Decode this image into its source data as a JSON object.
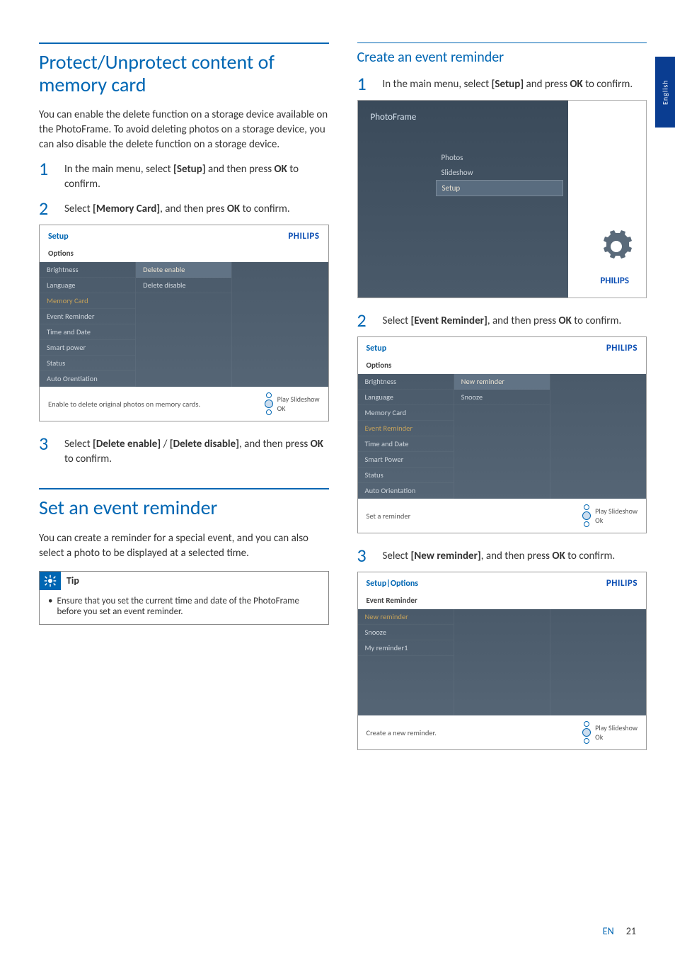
{
  "side_tab": "English",
  "left": {
    "h1": "Protect/Unprotect content of memory card",
    "intro": "You can enable the delete function on a storage device available on the PhotoFrame. To avoid deleting photos on a storage device, you can also disable the delete function on a storage device.",
    "step1_a": "In the main menu, select ",
    "step1_b": "[Setup]",
    "step1_c": " and then press ",
    "step1_d": "OK",
    "step1_e": " to confirm.",
    "step2_a": "Select ",
    "step2_b": "[Memory Card]",
    "step2_c": ", and then pres ",
    "step2_d": "OK",
    "step2_e": " to confirm.",
    "shot1": {
      "title": "Setup",
      "brand": "PHILIPS",
      "sub": "Options",
      "col1": [
        "Brightness",
        "Language",
        "Memory Card",
        "Event Reminder",
        "Time and Date",
        "Smart power",
        "Status",
        "Auto Orentiation"
      ],
      "col1_hl_index": 2,
      "col2": [
        "Delete enable",
        "Delete disable"
      ],
      "footer_text": "Enable to delete original photos on memory cards.",
      "play": "Play Slideshow",
      "ok": "OK"
    },
    "step3_a": "Select ",
    "step3_b": "[Delete enable]",
    "step3_c": " / ",
    "step3_d": "[Delete disable]",
    "step3_e": ", and then press ",
    "step3_f": "OK",
    "step3_g": " to confirm.",
    "h1b": "Set an event reminder",
    "intro2": "You can create a reminder for a special event, and you can also select a photo to be displayed at a selected time.",
    "tip_label": "Tip",
    "tip_text": "Ensure that you set the current time and date of the PhotoFrame before you set an event reminder."
  },
  "right": {
    "h2": "Create an event reminder",
    "step1_a": "In the main menu, select ",
    "step1_b": "[Setup]",
    "step1_c": " and press ",
    "step1_d": "OK",
    "step1_e": " to confirm.",
    "mainmenu": {
      "title": "PhotoFrame",
      "items": [
        "Photos",
        "Slideshow",
        "Setup"
      ],
      "sel_index": 2,
      "brand": "PHILIPS"
    },
    "step2_a": "Select ",
    "step2_b": "[Event Reminder]",
    "step2_c": ", and then press ",
    "step2_d": "OK",
    "step2_e": " to confirm.",
    "shot2": {
      "title": "Setup",
      "brand": "PHILIPS",
      "sub": "Options",
      "col1": [
        "Brightness",
        "Language",
        "Memory Card",
        "Event Reminder",
        "Time and Date",
        "Smart Power",
        "Status",
        "Auto Orientation"
      ],
      "col1_hl_index": 3,
      "col2": [
        "New reminder",
        "Snooze"
      ],
      "footer_text": "Set a reminder",
      "play": "Play Slideshow",
      "ok": "Ok"
    },
    "step3_a": "Select ",
    "step3_b": "[New reminder]",
    "step3_c": ", and then press ",
    "step3_d": "OK",
    "step3_e": " to confirm.",
    "shot3": {
      "title": "Setup|Options",
      "brand": "PHILIPS",
      "sub": "Event Reminder",
      "col1": [
        "New reminder",
        "Snooze",
        "My reminder1"
      ],
      "col1_hl_index": 0,
      "footer_text": "Create  a new reminder.",
      "play": "Play Slideshow",
      "ok": "Ok"
    }
  },
  "footer": {
    "lang": "EN",
    "page": "21"
  }
}
